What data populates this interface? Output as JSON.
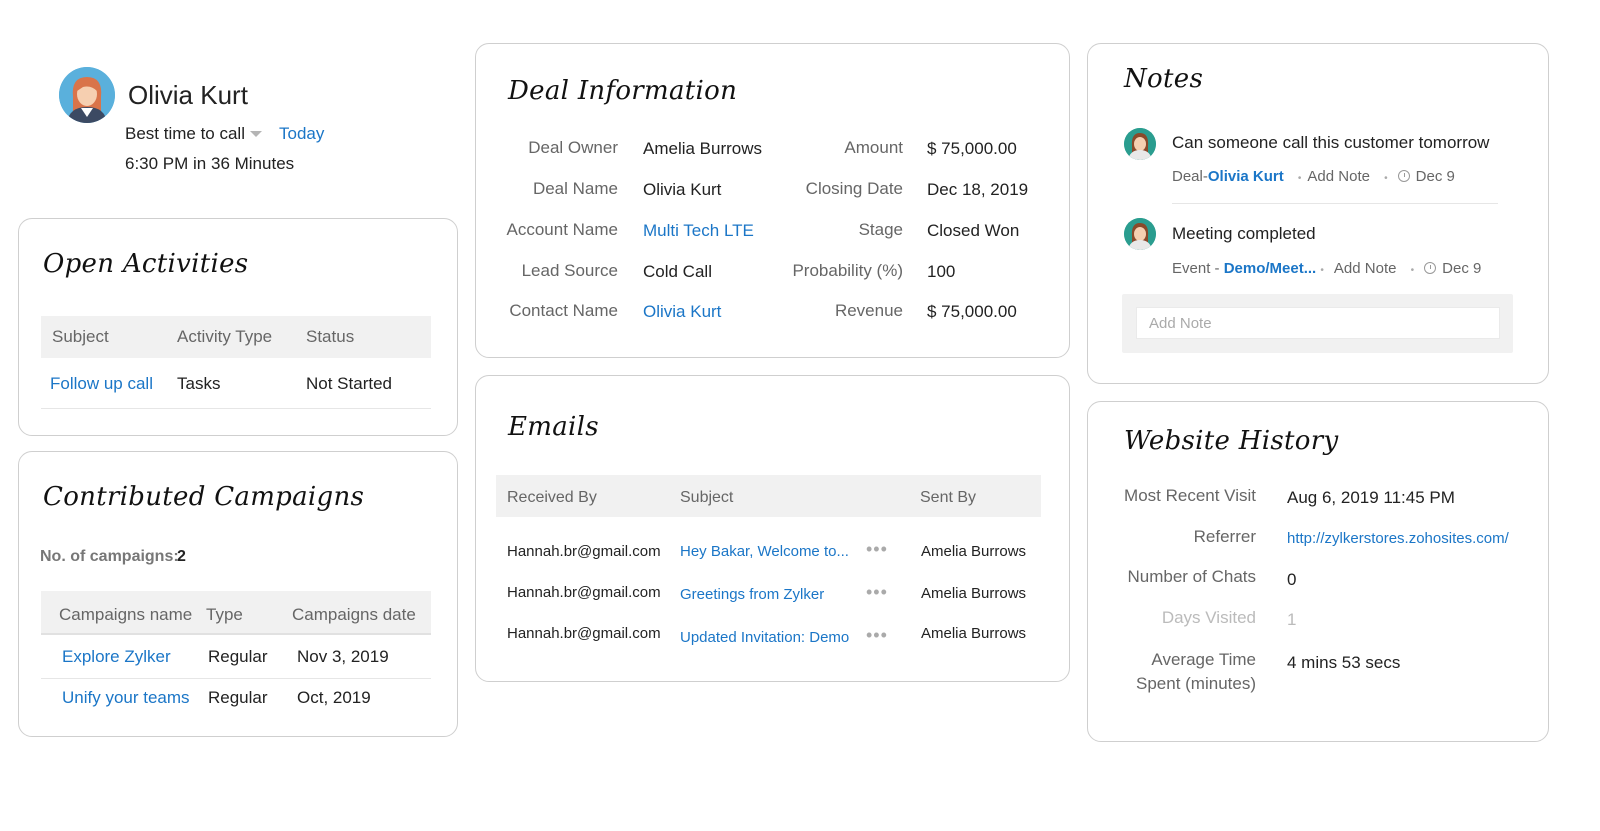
{
  "profile": {
    "name": "Olivia Kurt",
    "best_time_label": "Best time to call",
    "best_time_value": "Today",
    "time_text": "6:30 PM in 36 Minutes"
  },
  "open_activities": {
    "title": "Open Activities",
    "headers": [
      "Subject",
      "Activity Type",
      "Status"
    ],
    "rows": [
      {
        "subject": "Follow up call",
        "type": "Tasks",
        "status": "Not Started"
      }
    ]
  },
  "campaigns": {
    "title": "Contributed Campaigns",
    "count_label": "No. of campaigns:",
    "count_value": "2",
    "headers": [
      "Campaigns name",
      "Type",
      "Campaigns date"
    ],
    "rows": [
      {
        "name": "Explore Zylker",
        "type": "Regular",
        "date": "Nov 3, 2019"
      },
      {
        "name": "Unify your teams",
        "type": "Regular",
        "date": "Oct, 2019"
      }
    ]
  },
  "deal": {
    "title": "Deal Information",
    "left": [
      {
        "label": "Deal Owner",
        "value": "Amelia Burrows"
      },
      {
        "label": "Deal Name",
        "value": "Olivia Kurt"
      },
      {
        "label": "Account Name",
        "value": "Multi Tech LTE"
      },
      {
        "label": "Lead Source",
        "value": "Cold Call"
      },
      {
        "label": "Contact Name",
        "value": "Olivia Kurt"
      }
    ],
    "right": [
      {
        "label": "Amount",
        "value": "$ 75,000.00"
      },
      {
        "label": "Closing Date",
        "value": "Dec 18, 2019"
      },
      {
        "label": "Stage",
        "value": "Closed Won"
      },
      {
        "label": "Probability (%)",
        "value": "100"
      },
      {
        "label": "Revenue",
        "value": "$ 75,000.00"
      }
    ]
  },
  "emails": {
    "title": "Emails",
    "headers": [
      "Received By",
      "Subject",
      "Sent By"
    ],
    "rows": [
      {
        "received": "Hannah.br@gmail.com",
        "subject": "Hey Bakar, Welcome to...",
        "sent": "Amelia Burrows"
      },
      {
        "received": "Hannah.br@gmail.com",
        "subject": "Greetings from Zylker",
        "sent": "Amelia Burrows"
      },
      {
        "received": "Hannah.br@gmail.com",
        "subject": "Updated Invitation: Demo",
        "sent": "Amelia Burrows"
      }
    ],
    "more": "•••"
  },
  "notes": {
    "title": "Notes",
    "items": [
      {
        "text": "Can someone call this customer tomorrow",
        "prefix": "Deal-",
        "link": "Olivia Kurt",
        "action": "Add Note",
        "date": "Dec 9"
      },
      {
        "text": "Meeting completed",
        "prefix": "Event - ",
        "link": "Demo/Meet...",
        "action": "Add Note",
        "date": "Dec 9"
      }
    ],
    "separator": "•",
    "input_placeholder": "Add Note"
  },
  "website": {
    "title": "Website History",
    "rows": [
      {
        "label": "Most Recent Visit",
        "value": "Aug 6, 2019 11:45 PM"
      },
      {
        "label": "Referrer",
        "value": "http://zylkerstores.zohosites.com/"
      },
      {
        "label": "Number of Chats",
        "value": "0"
      },
      {
        "label": "Days Visited",
        "value": "1"
      },
      {
        "label_line1": "Average Time",
        "label_line2": "Spent (minutes)",
        "value": "4 mins 53 secs"
      }
    ]
  }
}
